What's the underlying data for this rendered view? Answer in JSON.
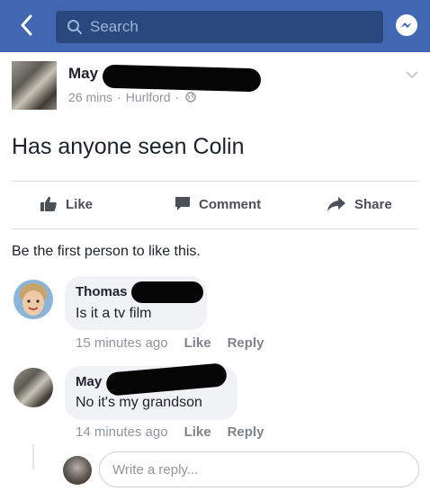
{
  "topbar": {
    "search_placeholder": "Search",
    "back_icon": "chevron-left-icon",
    "messenger_icon": "messenger-icon",
    "color": "#4267b2"
  },
  "post": {
    "author": "May",
    "time": "26 mins",
    "separator": "·",
    "location": "Hurlford",
    "separator2": "·",
    "text": "Has anyone seen Colin"
  },
  "actions": {
    "like": "Like",
    "comment": "Comment",
    "share": "Share"
  },
  "likes_line": "Be the first person to like this.",
  "comments": [
    {
      "author": "Thomas",
      "text": "Is it a tv film",
      "time": "15 minutes ago",
      "like": "Like",
      "reply": "Reply"
    },
    {
      "author": "May",
      "text": "No it's my grandson",
      "time": "14 minutes ago",
      "like": "Like",
      "reply": "Reply"
    }
  ],
  "reply_box": {
    "placeholder": "Write a reply..."
  }
}
